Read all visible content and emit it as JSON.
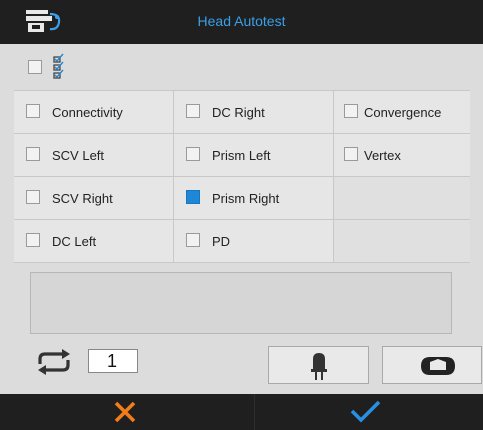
{
  "window": {
    "title": "Head Autotest",
    "app_icon": "head-device-icon"
  },
  "select_all": {
    "checked": false,
    "icon": "checklist-icon"
  },
  "tests": [
    {
      "label": "Connectivity",
      "checked": false
    },
    {
      "label": "DC Right",
      "checked": false
    },
    {
      "label": "Convergence",
      "checked": false
    },
    {
      "label": "SCV Left",
      "checked": false
    },
    {
      "label": "Prism Left",
      "checked": false
    },
    {
      "label": "Vertex",
      "checked": false
    },
    {
      "label": "SCV Right",
      "checked": false
    },
    {
      "label": "Prism Right",
      "checked": true
    },
    {
      "label": "",
      "checked": false
    },
    {
      "label": "DC Left",
      "checked": false
    },
    {
      "label": "PD",
      "checked": false
    },
    {
      "label": "",
      "checked": false
    }
  ],
  "message": "",
  "repeat": {
    "icon": "repeat-icon",
    "count": "1"
  },
  "tools": {
    "light_icon": "light-bulb-icon",
    "head_icon": "head-position-icon"
  },
  "actions": {
    "cancel_icon": "close-icon",
    "ok_icon": "checkmark-icon"
  },
  "colors": {
    "accent": "#1e88d6",
    "title_text": "#3aa0e8",
    "cancel": "#f07d1a",
    "ok": "#2a8fe0",
    "bar": "#1f1f1f"
  }
}
